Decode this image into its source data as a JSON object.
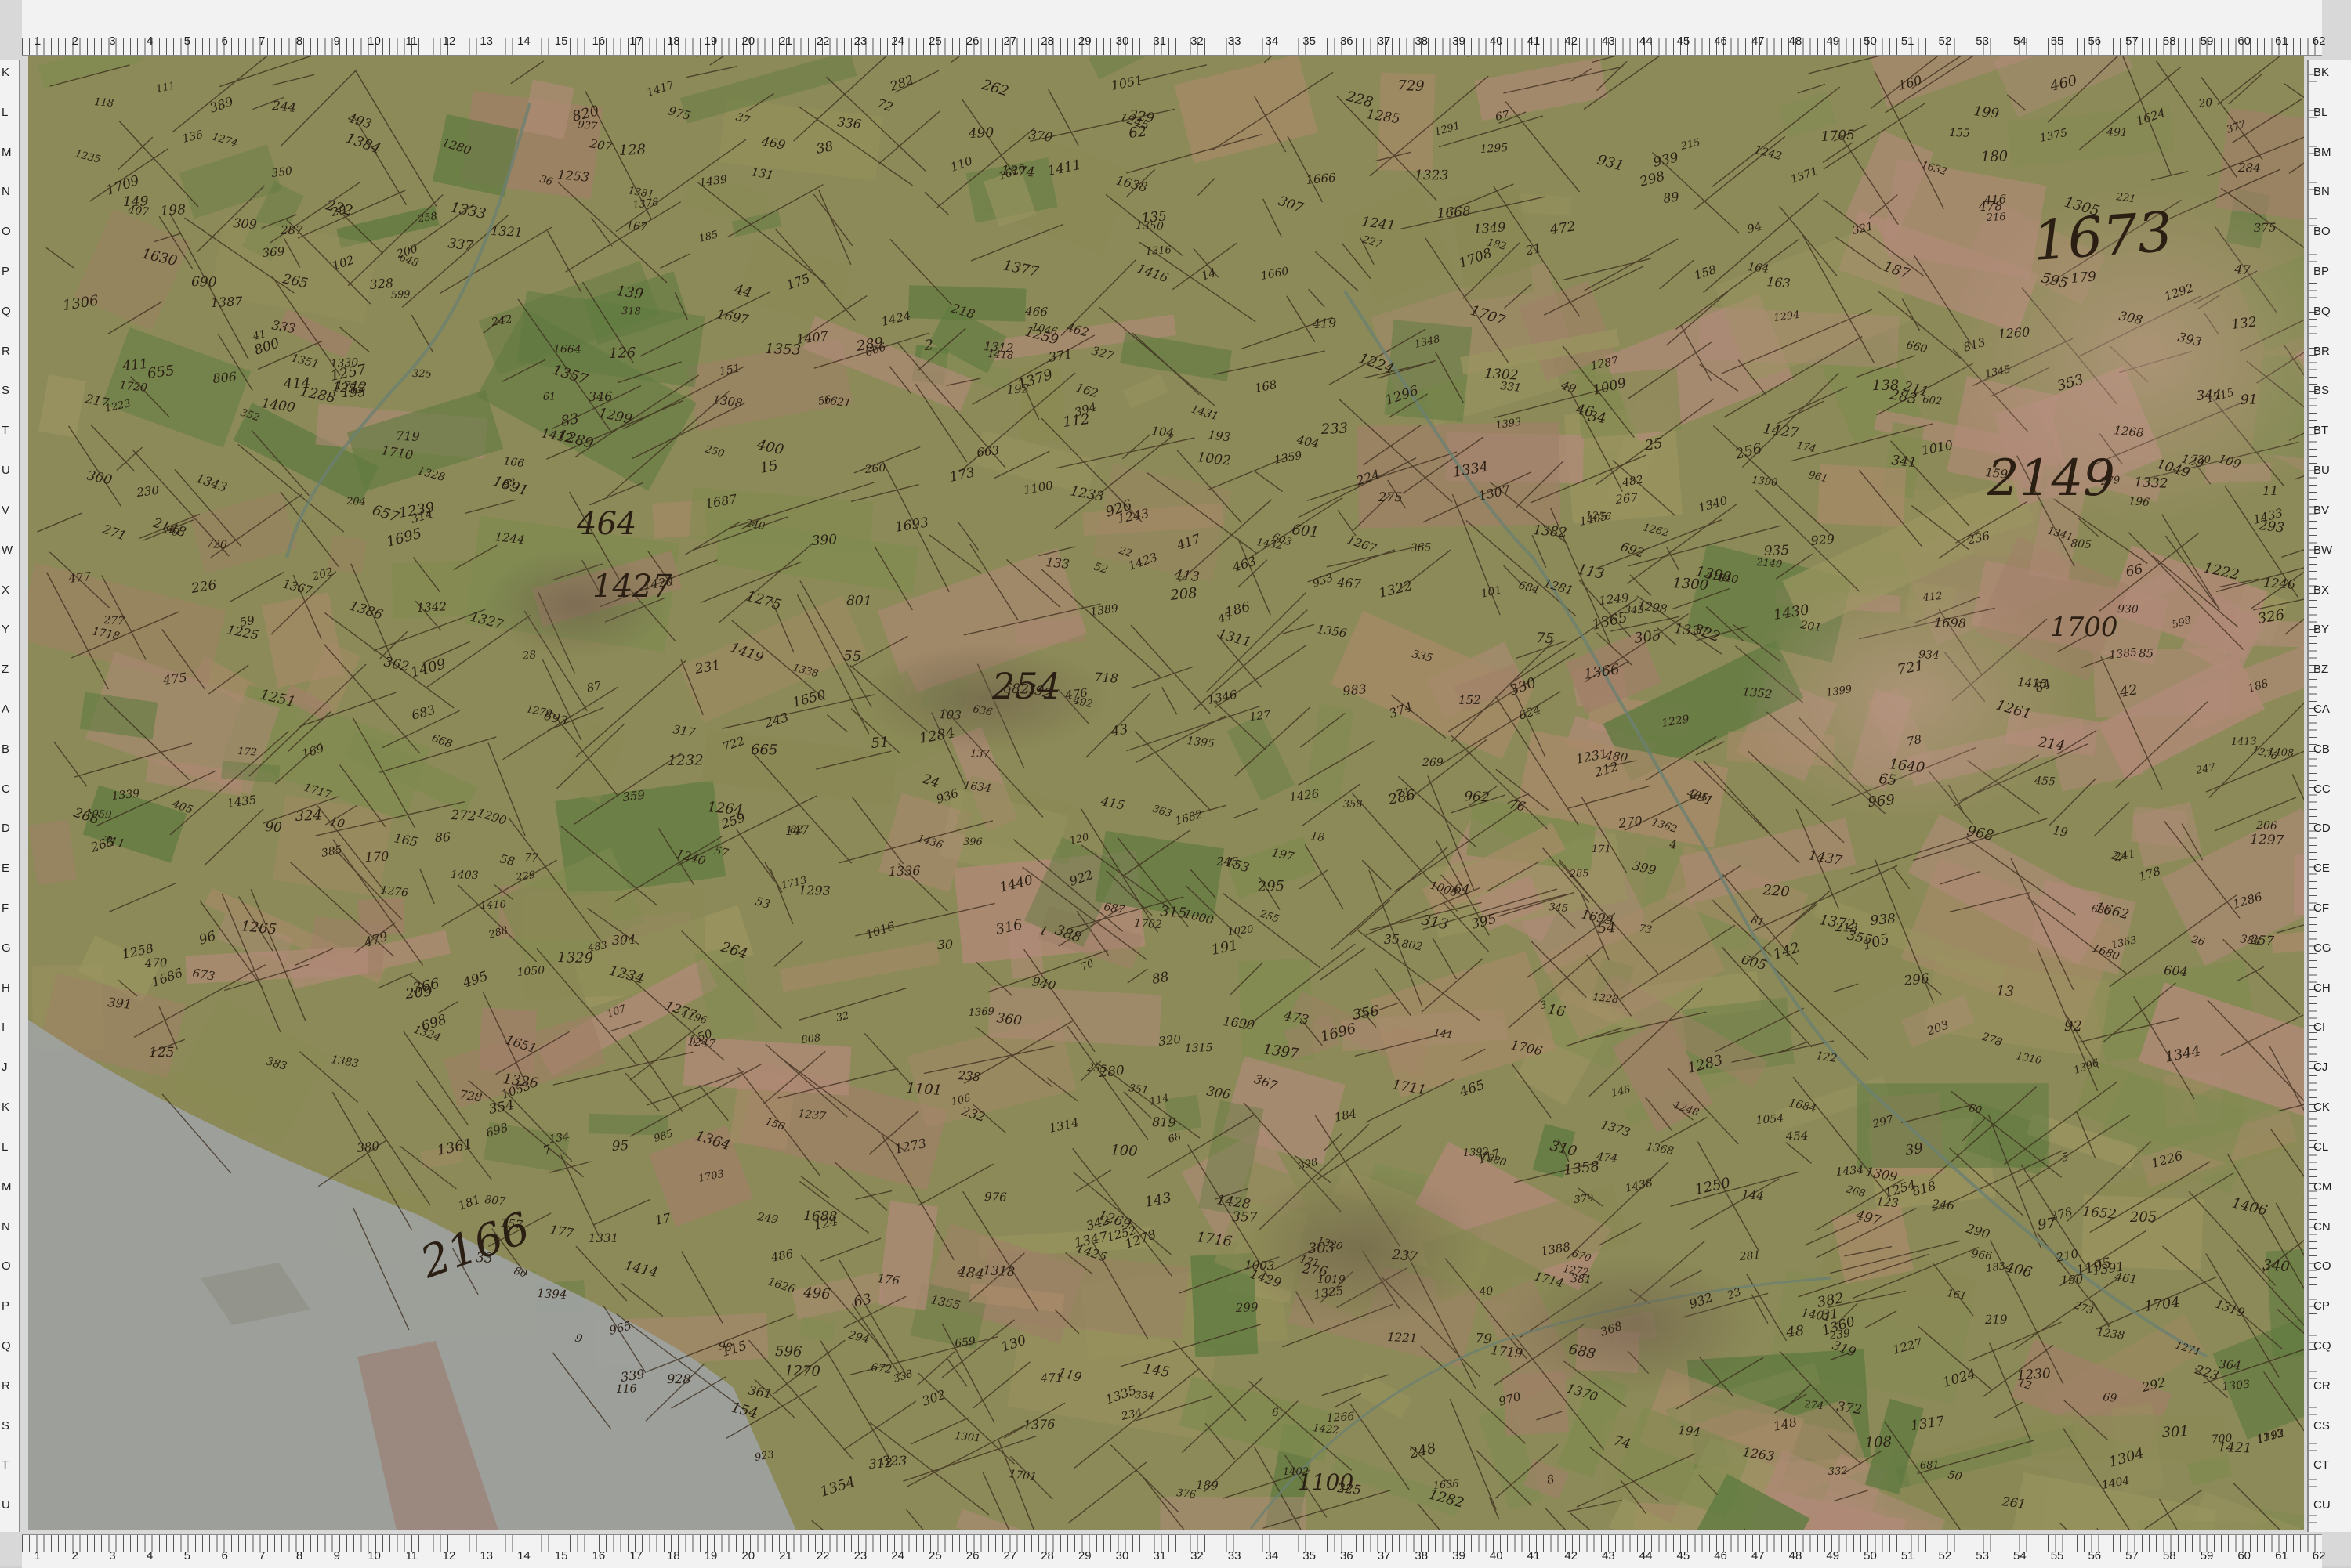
{
  "ruler": {
    "columns": [
      "1",
      "2",
      "3",
      "4",
      "5",
      "6",
      "7",
      "8",
      "9",
      "10",
      "11",
      "12",
      "13",
      "14",
      "15",
      "16",
      "17",
      "18",
      "19",
      "20",
      "21",
      "22",
      "23",
      "24",
      "25",
      "26",
      "27",
      "28",
      "29",
      "30",
      "31",
      "32",
      "33",
      "34",
      "35",
      "36",
      "37",
      "38",
      "39",
      "40",
      "41",
      "42",
      "43",
      "44",
      "45",
      "46",
      "47",
      "48",
      "49",
      "50",
      "51",
      "52",
      "53",
      "54",
      "55",
      "56",
      "57",
      "58",
      "59",
      "60",
      "61",
      "62"
    ],
    "rows_left": [
      "K",
      "L",
      "M",
      "N",
      "O",
      "P",
      "Q",
      "R",
      "S",
      "T",
      "U",
      "V",
      "W",
      "X",
      "Y",
      "Z",
      "A",
      "B",
      "C",
      "D",
      "E",
      "F",
      "G",
      "H",
      "I",
      "J",
      "K",
      "L",
      "M",
      "N",
      "O",
      "P",
      "Q",
      "R",
      "S",
      "T",
      "U"
    ],
    "rows_right": [
      "BK",
      "BL",
      "BM",
      "BN",
      "BO",
      "BP",
      "BQ",
      "BR",
      "BS",
      "BT",
      "BU",
      "BV",
      "BW",
      "BX",
      "BY",
      "BZ",
      "CA",
      "CB",
      "CC",
      "CD",
      "CE",
      "CF",
      "CG",
      "CH",
      "CI",
      "CJ",
      "CK",
      "CL",
      "CM",
      "CN",
      "CO",
      "CP",
      "CQ",
      "CR",
      "CS",
      "CT",
      "CU"
    ]
  },
  "map": {
    "colors": {
      "meadow": "#8a8a55",
      "field": "#a88a6a",
      "pink": "#b08a78",
      "water": "#9ea2a0",
      "ink": "#3a2a1c",
      "forest": "#5f7a40"
    },
    "large_labels": [
      "1673",
      "2149",
      "2166",
      "1700",
      "254",
      "1427",
      "464",
      "1100"
    ],
    "parcels": [
      "687",
      "681",
      "684",
      "682",
      "683",
      "692",
      "698",
      "800",
      "801",
      "802",
      "805",
      "806",
      "807",
      "808",
      "813",
      "818",
      "819",
      "820",
      "698",
      "686",
      "624",
      "700",
      "693",
      "690",
      "688",
      "668",
      "666",
      "663",
      "665",
      "670",
      "660",
      "659",
      "657",
      "655",
      "636",
      "648",
      "672",
      "673",
      "718",
      "719",
      "720",
      "721",
      "722",
      "728",
      "729",
      "730",
      "601",
      "602",
      "603",
      "596",
      "598",
      "599",
      "604",
      "605",
      "595",
      "497",
      "496",
      "495",
      "493",
      "492",
      "491",
      "490",
      "476",
      "480",
      "482",
      "483",
      "484",
      "486",
      "485",
      "413",
      "414",
      "415",
      "416",
      "417",
      "418",
      "419",
      "411",
      "412",
      "406",
      "407",
      "405",
      "404",
      "454",
      "455",
      "460",
      "461",
      "462",
      "463",
      "465",
      "466",
      "467",
      "469",
      "470",
      "471",
      "472",
      "473",
      "474",
      "475",
      "477",
      "478",
      "479",
      "399",
      "398",
      "400",
      "396",
      "395",
      "394",
      "393",
      "392",
      "391",
      "390",
      "388",
      "389",
      "385",
      "384",
      "383",
      "382",
      "381",
      "380",
      "379",
      "378",
      "377",
      "376",
      "375",
      "374",
      "372",
      "371",
      "370",
      "369",
      "368",
      "367",
      "366",
      "365",
      "364",
      "363",
      "362",
      "361",
      "360",
      "359",
      "358",
      "357",
      "356",
      "355",
      "354",
      "353",
      "352",
      "351",
      "350",
      "346",
      "345",
      "344",
      "343",
      "342",
      "341",
      "340",
      "339",
      "338",
      "337",
      "336",
      "335",
      "334",
      "333",
      "332",
      "331",
      "330",
      "329",
      "328",
      "327",
      "326",
      "325",
      "324",
      "323",
      "322",
      "321",
      "320",
      "319",
      "318",
      "317",
      "316",
      "315",
      "314",
      "313",
      "312",
      "311",
      "310",
      "309",
      "308",
      "307",
      "306",
      "305",
      "304",
      "303",
      "302",
      "301",
      "300",
      "299",
      "298",
      "297",
      "296",
      "295",
      "294",
      "293",
      "292",
      "291",
      "290",
      "289",
      "288",
      "287",
      "286",
      "285",
      "284",
      "283",
      "282",
      "281",
      "280",
      "279",
      "278",
      "277",
      "276",
      "275",
      "274",
      "273",
      "272",
      "271",
      "270",
      "269",
      "268",
      "267",
      "266",
      "265",
      "264",
      "263",
      "262",
      "261",
      "260",
      "259",
      "258",
      "257",
      "256",
      "255",
      "250",
      "249",
      "248",
      "247",
      "246",
      "245",
      "244",
      "243",
      "242",
      "241",
      "240",
      "239",
      "238",
      "237",
      "236",
      "235",
      "234",
      "233",
      "232",
      "231",
      "230",
      "229",
      "228",
      "227",
      "226",
      "225",
      "224",
      "223",
      "222",
      "221",
      "220",
      "219",
      "218",
      "217",
      "216",
      "215",
      "214",
      "213",
      "212",
      "211",
      "210",
      "209",
      "208",
      "207",
      "206",
      "205",
      "204",
      "203",
      "202",
      "201",
      "200",
      "199",
      "198",
      "197",
      "196",
      "195",
      "194",
      "193",
      "192",
      "191",
      "190",
      "189",
      "188",
      "187",
      "186",
      "185",
      "184",
      "183",
      "182",
      "181",
      "180",
      "179",
      "178",
      "177",
      "176",
      "175",
      "174",
      "173",
      "172",
      "171",
      "170",
      "169",
      "168",
      "167",
      "166",
      "165",
      "164",
      "163",
      "162",
      "161",
      "160",
      "159",
      "158",
      "157",
      "156",
      "155",
      "154",
      "153",
      "152",
      "151",
      "150",
      "149",
      "148",
      "147",
      "146",
      "145",
      "144",
      "143",
      "142",
      "141",
      "140",
      "139",
      "138",
      "137",
      "136",
      "135",
      "134",
      "133",
      "132",
      "131",
      "130",
      "129",
      "128",
      "127",
      "126",
      "125",
      "124",
      "123",
      "122",
      "121",
      "120",
      "119",
      "118",
      "117",
      "116",
      "115",
      "114",
      "113",
      "112",
      "111",
      "110",
      "109",
      "108",
      "107",
      "106",
      "105",
      "104",
      "103",
      "102",
      "101",
      "100",
      "99",
      "98",
      "97",
      "96",
      "95",
      "94",
      "93",
      "92",
      "91",
      "90",
      "89",
      "88",
      "87",
      "86",
      "85",
      "84",
      "83",
      "82",
      "81",
      "80",
      "79",
      "78",
      "77",
      "76",
      "75",
      "74",
      "73",
      "72",
      "71",
      "70",
      "69",
      "68",
      "67",
      "66",
      "65",
      "64",
      "63",
      "62",
      "61",
      "60",
      "59",
      "58",
      "57",
      "56",
      "55",
      "54",
      "53",
      "52",
      "51",
      "50",
      "49",
      "48",
      "47",
      "46",
      "45",
      "44",
      "43",
      "42",
      "41",
      "40",
      "39",
      "38",
      "37",
      "36",
      "35",
      "34",
      "33",
      "32",
      "31",
      "30",
      "29",
      "28",
      "27",
      "26",
      "25",
      "24",
      "23",
      "22",
      "21",
      "20",
      "19",
      "18",
      "17",
      "16",
      "15",
      "14",
      "13",
      "12",
      "11",
      "10",
      "9",
      "8",
      "7",
      "6",
      "5",
      "4",
      "3",
      "2",
      "1",
      "1339",
      "1283",
      "1332",
      "1311",
      "1277",
      "1282",
      "1294",
      "1293",
      "1301",
      "1302",
      "1288",
      "1289",
      "1290",
      "1291",
      "1292",
      "1295",
      "1296",
      "1297",
      "1298",
      "1299",
      "1300",
      "1303",
      "1304",
      "1305",
      "1306",
      "1307",
      "1308",
      "1309",
      "1310",
      "1312",
      "1313",
      "1314",
      "1315",
      "1316",
      "1317",
      "1318",
      "1319",
      "1320",
      "1321",
      "1322",
      "1323",
      "1324",
      "1325",
      "1326",
      "1327",
      "1328",
      "1329",
      "1330",
      "1331",
      "1333",
      "1334",
      "1335",
      "1336",
      "1337",
      "1338",
      "1340",
      "1341",
      "1342",
      "1343",
      "1344",
      "1345",
      "1346",
      "1347",
      "1348",
      "1349",
      "1350",
      "1351",
      "1352",
      "1353",
      "1354",
      "1355",
      "1356",
      "1357",
      "1358",
      "1359",
      "1360",
      "1361",
      "1362",
      "1363",
      "1364",
      "1365",
      "1366",
      "1367",
      "1368",
      "1369",
      "1370",
      "1371",
      "1372",
      "1373",
      "1374",
      "1375",
      "1376",
      "1377",
      "1378",
      "1379",
      "1380",
      "1381",
      "1382",
      "1383",
      "1384",
      "1385",
      "1386",
      "1387",
      "1388",
      "1389",
      "1390",
      "1391",
      "1392",
      "1393",
      "1394",
      "1395",
      "1396",
      "1397",
      "1398",
      "1399",
      "1400",
      "1401",
      "1402",
      "1403",
      "1404",
      "1405",
      "1406",
      "1407",
      "1408",
      "1409",
      "1410",
      "1411",
      "1412",
      "1413",
      "1414",
      "1415",
      "1416",
      "1417",
      "1418",
      "1419",
      "1420",
      "1421",
      "1422",
      "1423",
      "1424",
      "1425",
      "1426",
      "1427",
      "1428",
      "1429",
      "1430",
      "1431",
      "1432",
      "1433",
      "1434",
      "1435",
      "1436",
      "1437",
      "1438",
      "1439",
      "1440",
      "1620",
      "1621",
      "1624",
      "1626",
      "1630",
      "1632",
      "1634",
      "1636",
      "1638",
      "1640",
      "1650",
      "1651",
      "1652",
      "1660",
      "1662",
      "1664",
      "1666",
      "1668",
      "1680",
      "1682",
      "1684",
      "1686",
      "1687",
      "1688",
      "1690",
      "1691",
      "1693",
      "1695",
      "1696",
      "1697",
      "1698",
      "1699",
      "1701",
      "1702",
      "1703",
      "1704",
      "1705",
      "1706",
      "1707",
      "1708",
      "1709",
      "1710",
      "1711",
      "1712",
      "1713",
      "1714",
      "1715",
      "1716",
      "1717",
      "1718",
      "1719",
      "1720",
      "1221",
      "1222",
      "1223",
      "1224",
      "1225",
      "1226",
      "1227",
      "1228",
      "1229",
      "1230",
      "1231",
      "1232",
      "1233",
      "1234",
      "1235",
      "1236",
      "1237",
      "1238",
      "1239",
      "1240",
      "1241",
      "1242",
      "1243",
      "1244",
      "1245",
      "1246",
      "1247",
      "1248",
      "1249",
      "1250",
      "1251",
      "1252",
      "1253",
      "1254",
      "1255",
      "1256",
      "1257",
      "1258",
      "1259",
      "1260",
      "1261",
      "1262",
      "1263",
      "1264",
      "1265",
      "1266",
      "1267",
      "1268",
      "1269",
      "1270",
      "1271",
      "1272",
      "1273",
      "1274",
      "1275",
      "1276",
      "1278",
      "1279",
      "1280",
      "1281",
      "1284",
      "1285",
      "1286",
      "1287",
      "1196",
      "1195",
      "1192",
      "1003",
      "1008",
      "1009",
      "1010",
      "1016",
      "1019",
      "1020",
      "1024",
      "1046",
      "1049",
      "1050",
      "1051",
      "1053",
      "1054",
      "1059",
      "962",
      "961",
      "965",
      "966",
      "968",
      "969",
      "970",
      "975",
      "976",
      "983",
      "985",
      "922",
      "923",
      "926",
      "928",
      "929",
      "930",
      "931",
      "932",
      "933",
      "934",
      "935",
      "936",
      "937",
      "938",
      "939",
      "940",
      "1101",
      "1002",
      "1000",
      "1100",
      "2140",
      "2148"
    ]
  }
}
